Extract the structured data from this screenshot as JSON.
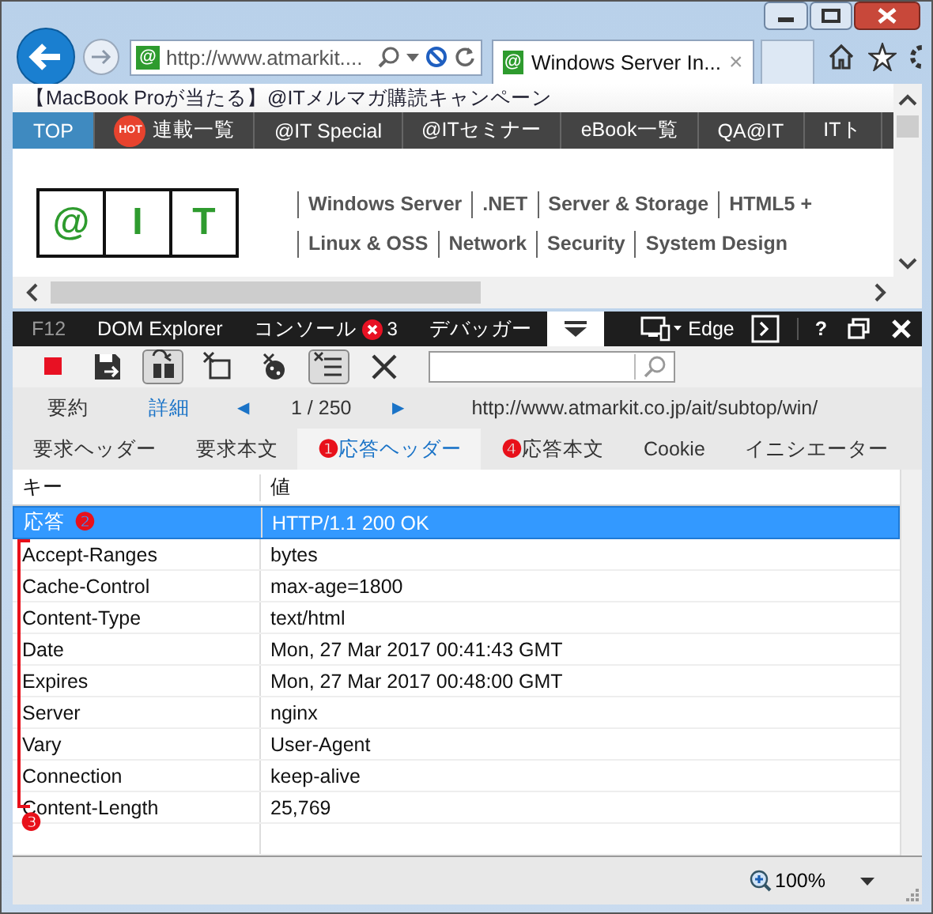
{
  "browser": {
    "favicon": "@",
    "address": "http://www.atmarkit....",
    "tab_title": "Windows Server In...",
    "tab_close": "×"
  },
  "page": {
    "banner": "【MacBook Proが当たる】@ITメルマガ購読キャンペーン",
    "nav": [
      {
        "label": "TOP",
        "selected": true
      },
      {
        "label": "連載一覧",
        "badge": "HOT",
        "selected": false
      },
      {
        "label": "@IT Special",
        "selected": false
      },
      {
        "label": "@ITセミナー",
        "selected": false
      },
      {
        "label": "eBook一覧",
        "selected": false
      },
      {
        "label": "QA@IT",
        "selected": false
      },
      {
        "label": "ITト",
        "selected": false
      }
    ],
    "logo": [
      "@",
      "I",
      "T"
    ],
    "links": [
      [
        "Windows Server",
        ".NET",
        "Server & Storage",
        "HTML5 +"
      ],
      [
        "Linux & OSS",
        "Network",
        "Security",
        "System Design"
      ]
    ]
  },
  "devtools": {
    "label": "F12",
    "tabs": [
      {
        "label": "DOM Explorer",
        "selected": false
      },
      {
        "label": "コンソール",
        "errors": "3",
        "selected": false
      },
      {
        "label": "デバッガー",
        "selected": false
      },
      {
        "kind": "icon",
        "selected": true
      }
    ],
    "mode": "Edge",
    "help": "?",
    "toolbar": [
      {
        "kind": "stop",
        "on": false
      },
      {
        "kind": "save",
        "on": false
      },
      {
        "kind": "cache",
        "on": true
      },
      {
        "kind": "clear-page",
        "on": false
      },
      {
        "kind": "cookies",
        "on": false
      },
      {
        "kind": "list",
        "on": true
      },
      {
        "kind": "clear",
        "on": false
      }
    ],
    "views": [
      {
        "label": "要約",
        "selected": false
      },
      {
        "label": "詳細",
        "selected": true
      }
    ],
    "position": "1 / 250",
    "prev": "◀",
    "next": "▶",
    "url": "http://www.atmarkit.co.jp/ait/subtop/win/",
    "detail_tabs": [
      {
        "label": "要求ヘッダー",
        "selected": false
      },
      {
        "label": "要求本文",
        "selected": false
      },
      {
        "label": "応答ヘッダー",
        "marker": "❶",
        "selected": true
      },
      {
        "label": "応答本文",
        "marker": "❹",
        "selected": false
      },
      {
        "label": "Cookie",
        "selected": false
      },
      {
        "label": "イニシエーター",
        "selected": false
      }
    ],
    "table": {
      "columns": [
        "キー",
        "値"
      ],
      "rows": [
        {
          "key": "応答",
          "value": "HTTP/1.1 200 OK",
          "marker": "❷",
          "selected": true
        },
        {
          "key": "Accept-Ranges",
          "value": "bytes",
          "selected": false
        },
        {
          "key": "Cache-Control",
          "value": "max-age=1800",
          "selected": false
        },
        {
          "key": "Content-Type",
          "value": "text/html",
          "selected": false
        },
        {
          "key": "Date",
          "value": "Mon, 27 Mar 2017 00:41:43 GMT",
          "selected": false
        },
        {
          "key": "Expires",
          "value": "Mon, 27 Mar 2017 00:48:00 GMT",
          "selected": false
        },
        {
          "key": "Server",
          "value": "nginx",
          "selected": false
        },
        {
          "key": "Vary",
          "value": "User-Agent",
          "selected": false
        },
        {
          "key": "Connection",
          "value": "keep-alive",
          "selected": false
        },
        {
          "key": "Content-Length",
          "value": "25,769",
          "selected": false
        }
      ],
      "bracket_marker": "❸"
    },
    "zoom": "100%"
  }
}
